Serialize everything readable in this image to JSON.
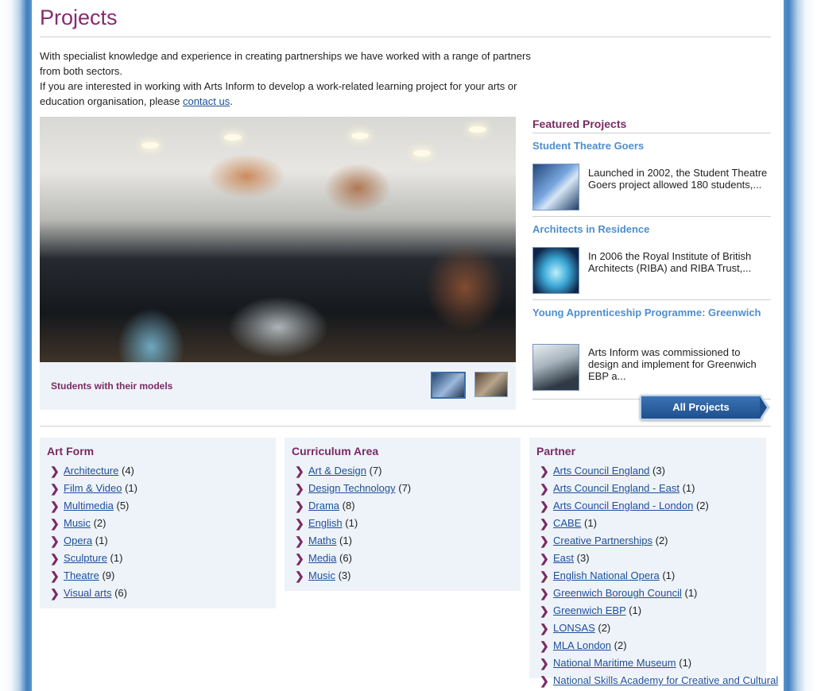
{
  "page": {
    "title": "Projects",
    "intro_line1": "With specialist knowledge and experience in creating partnerships we have worked with a range of partners from both sectors.",
    "intro_line2_before": "If you are interested in working with Arts Inform to develop a work-related learning project for your arts or education organisation, please ",
    "intro_link": "contact us",
    "intro_line2_after": "."
  },
  "hero": {
    "caption": "Students with their models",
    "image_icon": "photo-students-icon"
  },
  "featured": {
    "heading": "Featured Projects",
    "items": [
      {
        "title": "Student Theatre Goers",
        "desc": "Launched in 2002, the Student Theatre Goers project allowed 180 students,..."
      },
      {
        "title": "Architects in Residence",
        "desc": "In 2006 the Royal Institute of British Architects (RIBA) and RIBA Trust,..."
      },
      {
        "title": "Young Apprenticeship Programme: Greenwich",
        "desc": "Arts Inform was commissioned to design and implement for Greenwich EBP a..."
      }
    ],
    "all_button": "All Projects"
  },
  "facets": [
    {
      "heading": "Art Form",
      "items": [
        {
          "label": "Architecture",
          "count": "(4)"
        },
        {
          "label": "Film & Video",
          "count": "(1)"
        },
        {
          "label": "Multimedia",
          "count": "(5)"
        },
        {
          "label": "Music",
          "count": "(2)"
        },
        {
          "label": "Opera",
          "count": "(1)"
        },
        {
          "label": "Sculpture",
          "count": "(1)"
        },
        {
          "label": "Theatre",
          "count": "(9)"
        },
        {
          "label": "Visual arts",
          "count": "(6)"
        }
      ]
    },
    {
      "heading": "Curriculum Area",
      "items": [
        {
          "label": "Art & Design",
          "count": "(7)"
        },
        {
          "label": "Design Technology",
          "count": "(7)"
        },
        {
          "label": "Drama",
          "count": "(8)"
        },
        {
          "label": "English",
          "count": "(1)"
        },
        {
          "label": "Maths",
          "count": "(1)"
        },
        {
          "label": "Media",
          "count": "(6)"
        },
        {
          "label": "Music",
          "count": "(3)"
        }
      ]
    },
    {
      "heading": "Partner",
      "items": [
        {
          "label": "Arts Council England",
          "count": "(3)"
        },
        {
          "label": "Arts Council England - East",
          "count": "(1)"
        },
        {
          "label": "Arts Council England - London",
          "count": "(2)"
        },
        {
          "label": "CABE",
          "count": "(1)"
        },
        {
          "label": "Creative Partnerships",
          "count": "(2)"
        },
        {
          "label": "East",
          "count": "(3)"
        },
        {
          "label": "English National Opera",
          "count": "(1)"
        },
        {
          "label": "Greenwich Borough Council",
          "count": "(1)"
        },
        {
          "label": "Greenwich EBP",
          "count": "(1)"
        },
        {
          "label": "LONSAS",
          "count": "(2)"
        },
        {
          "label": "MLA London",
          "count": "(2)"
        },
        {
          "label": "National Maritime Museum",
          "count": "(1)"
        },
        {
          "label": "National Skills Academy for Creative and Cultural",
          "count": ""
        }
      ]
    }
  ],
  "colors": {
    "heading_purple": "#8a2a6e",
    "link_blue": "#1d4f9a",
    "featured_title_blue": "#4d8fcf",
    "panel_bg": "#eef3f9"
  }
}
